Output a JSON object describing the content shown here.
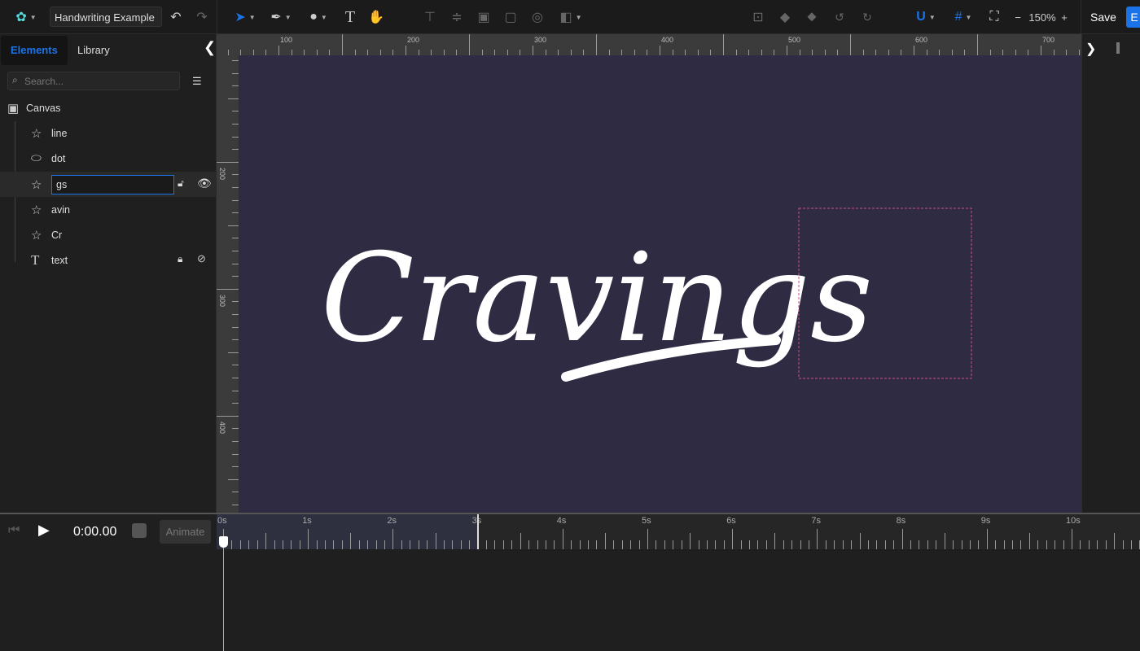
{
  "app": {
    "logo_icon": "palette-logo-icon",
    "document_title": "Handwriting Example"
  },
  "toolbar": {
    "tools": [
      "select-tool",
      "pen-tool",
      "shape-tool",
      "text-tool",
      "hand-tool"
    ],
    "zoom_level": "150%",
    "zoom_out": "−",
    "zoom_in": "+",
    "save_label": "Save",
    "export_label": "E",
    "accent": "#1a73e8"
  },
  "left_panel": {
    "tabs": [
      {
        "label": "Elements",
        "active": true
      },
      {
        "label": "Library",
        "active": false
      }
    ],
    "search_placeholder": "Search...",
    "root": "Canvas",
    "items": [
      {
        "label": "line",
        "icon": "path-icon"
      },
      {
        "label": "dot",
        "icon": "ellipse-icon"
      },
      {
        "label": "gs",
        "icon": "path-icon",
        "editing": true,
        "locked": false,
        "visible": true
      },
      {
        "label": "avin",
        "icon": "path-icon"
      },
      {
        "label": "Cr",
        "icon": "path-icon"
      },
      {
        "label": "text",
        "icon": "text-icon",
        "locked": true,
        "visible": false
      }
    ]
  },
  "rulers": {
    "top": [
      "100",
      "200",
      "300",
      "400",
      "500",
      "600",
      "700"
    ],
    "left": [
      "200",
      "300",
      "400"
    ]
  },
  "canvas": {
    "artwork_text": "Cravings",
    "background": "#2e2b42"
  },
  "timeline": {
    "time": "0:00.00",
    "animate_label": "Animate",
    "marks": [
      "0s",
      "1s",
      "2s",
      "3s",
      "4s",
      "5s",
      "6s",
      "7s",
      "8s",
      "9s",
      "10s"
    ]
  }
}
